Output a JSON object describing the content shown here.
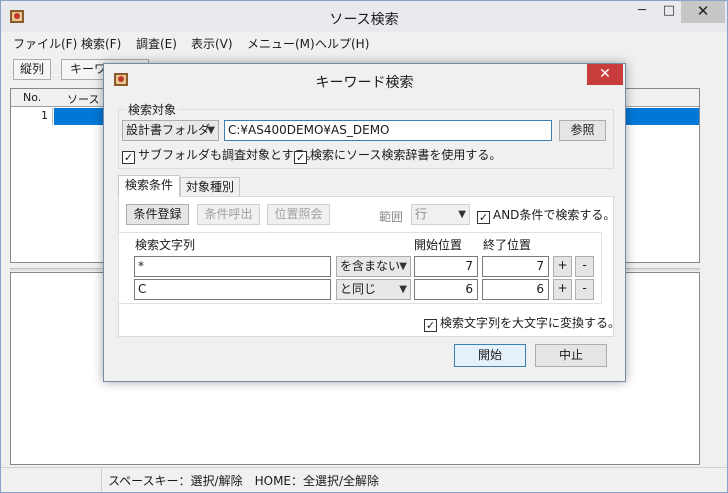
{
  "main": {
    "title": "ソース検索",
    "menu": [
      "ファイル(F)",
      "検索(F)",
      "調査(E)",
      "表示(V)",
      "メニュー(M)",
      "ヘルプ(H)"
    ],
    "toolbar": {
      "vertical_btn": "縦列",
      "keyword_btn": "キーワ"
    },
    "grid": {
      "col_no": "No.",
      "col_source": "ソース",
      "row1_no": "1"
    },
    "status_text": "スペースキー：選択/解除　HOME：全選択/全解除",
    "controls": {
      "minimize": "─",
      "maximize": "□",
      "close": "✕"
    }
  },
  "dialog": {
    "title": "キーワード検索",
    "close": "✕",
    "target_group": "検索対象",
    "target_select": "設計書フォルダ",
    "path_value": "C:¥AS400DEMO¥AS_DEMO",
    "browse_btn": "参照",
    "chk_subfolders": "サブフォルダも調査対象とする。",
    "chk_dictionary": "検索にソース検索辞書を使用する。",
    "tabs": [
      "検索条件",
      "対象種別"
    ],
    "btn_register": "条件登録",
    "btn_recall": "条件呼出",
    "btn_position": "位置照会",
    "range_label": "範囲",
    "range_value": "行",
    "chk_and": "AND条件で検索する。",
    "col_search": "検索文字列",
    "col_start": "開始位置",
    "col_end": "終了位置",
    "rows": [
      {
        "text": "*",
        "op": "を含まない",
        "start": "7",
        "end": "7"
      },
      {
        "text": "C",
        "op": "と同じ",
        "start": "6",
        "end": "6"
      }
    ],
    "plus": "+",
    "minus": "-",
    "chk_upper": "検索文字列を大文字に変換する。",
    "btn_start": "開始",
    "btn_cancel": "中止",
    "checked_mark": "✓"
  }
}
